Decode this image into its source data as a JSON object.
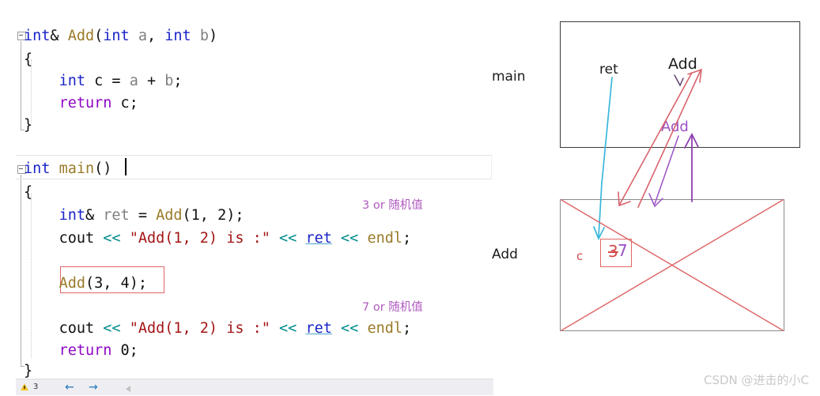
{
  "editor": {
    "code_lines": [
      {
        "id": "l1",
        "text": "int& Add(int a, int b)"
      },
      {
        "id": "l2",
        "text": "{"
      },
      {
        "id": "l3",
        "text": "    int c = a + b;"
      },
      {
        "id": "l4",
        "text": "    return c;"
      },
      {
        "id": "l5",
        "text": "}"
      },
      {
        "id": "l6",
        "text": "int main()"
      },
      {
        "id": "l7",
        "text": "{"
      },
      {
        "id": "l8",
        "text": "    int& ret = Add(1, 2);"
      },
      {
        "id": "l9",
        "text": "    cout << \"Add(1, 2) is :\" << ret << endl;"
      },
      {
        "id": "l10",
        "text": "    Add(3, 4);"
      },
      {
        "id": "l11",
        "text": "    cout << \"Add(1, 2) is :\" << ret << endl;"
      },
      {
        "id": "l12",
        "text": "    return 0;"
      },
      {
        "id": "l13",
        "text": "}"
      }
    ],
    "tokens": {
      "type_int": "int",
      "amp": "&",
      "fn_add": "Add",
      "param_a": "a",
      "param_b": "b",
      "comma_space": ", ",
      "open_paren": "(",
      "close_paren": ")",
      "brace_open": "{",
      "brace_close": "}",
      "var_c": "c",
      "assign": " = ",
      "plus": " + ",
      "semi": ";",
      "kw_return": "return",
      "fn_main": "main",
      "var_ret": "ret",
      "cout": "cout",
      "shift": "<<",
      "string_literal": "\"Add(1, 2) is :\"",
      "endl": "endl",
      "zero": "0",
      "args_1_2": "1, 2",
      "args_3_4": "3, 4"
    },
    "annotations": [
      {
        "id": "a1",
        "text": "3 or 随机值"
      },
      {
        "id": "a2",
        "text": "7 or 随机值"
      }
    ],
    "statusbar": {
      "warning_count": "3",
      "back_arrow": "←",
      "forward_arrow": "→"
    }
  },
  "diagram": {
    "frame_labels": [
      {
        "id": "main_frame",
        "text": "main"
      },
      {
        "id": "add_frame",
        "text": "Add"
      }
    ],
    "hand_labels": [
      {
        "id": "ret_label",
        "text": "ret",
        "color": "#2aa6d8"
      },
      {
        "id": "add_label_black",
        "text": "Add",
        "color": "#1a1a1a"
      },
      {
        "id": "add_label_purple",
        "text": "Add",
        "color": "#9b51c4"
      },
      {
        "id": "c_label",
        "text": "c",
        "color": "#d24a4a"
      },
      {
        "id": "value_old",
        "text": "3",
        "color": "#d24a4a"
      },
      {
        "id": "value_new",
        "text": "7",
        "color": "#9b51c4"
      }
    ],
    "colors": {
      "red": "#d9636b",
      "purple": "#9b51c4",
      "cyan": "#39b7dd",
      "box_border": "#3a3a3a",
      "box_border_grey": "#8a8a8a",
      "cross": "#e06a6a"
    }
  },
  "watermark": {
    "text": "CSDN @进击的小C"
  }
}
